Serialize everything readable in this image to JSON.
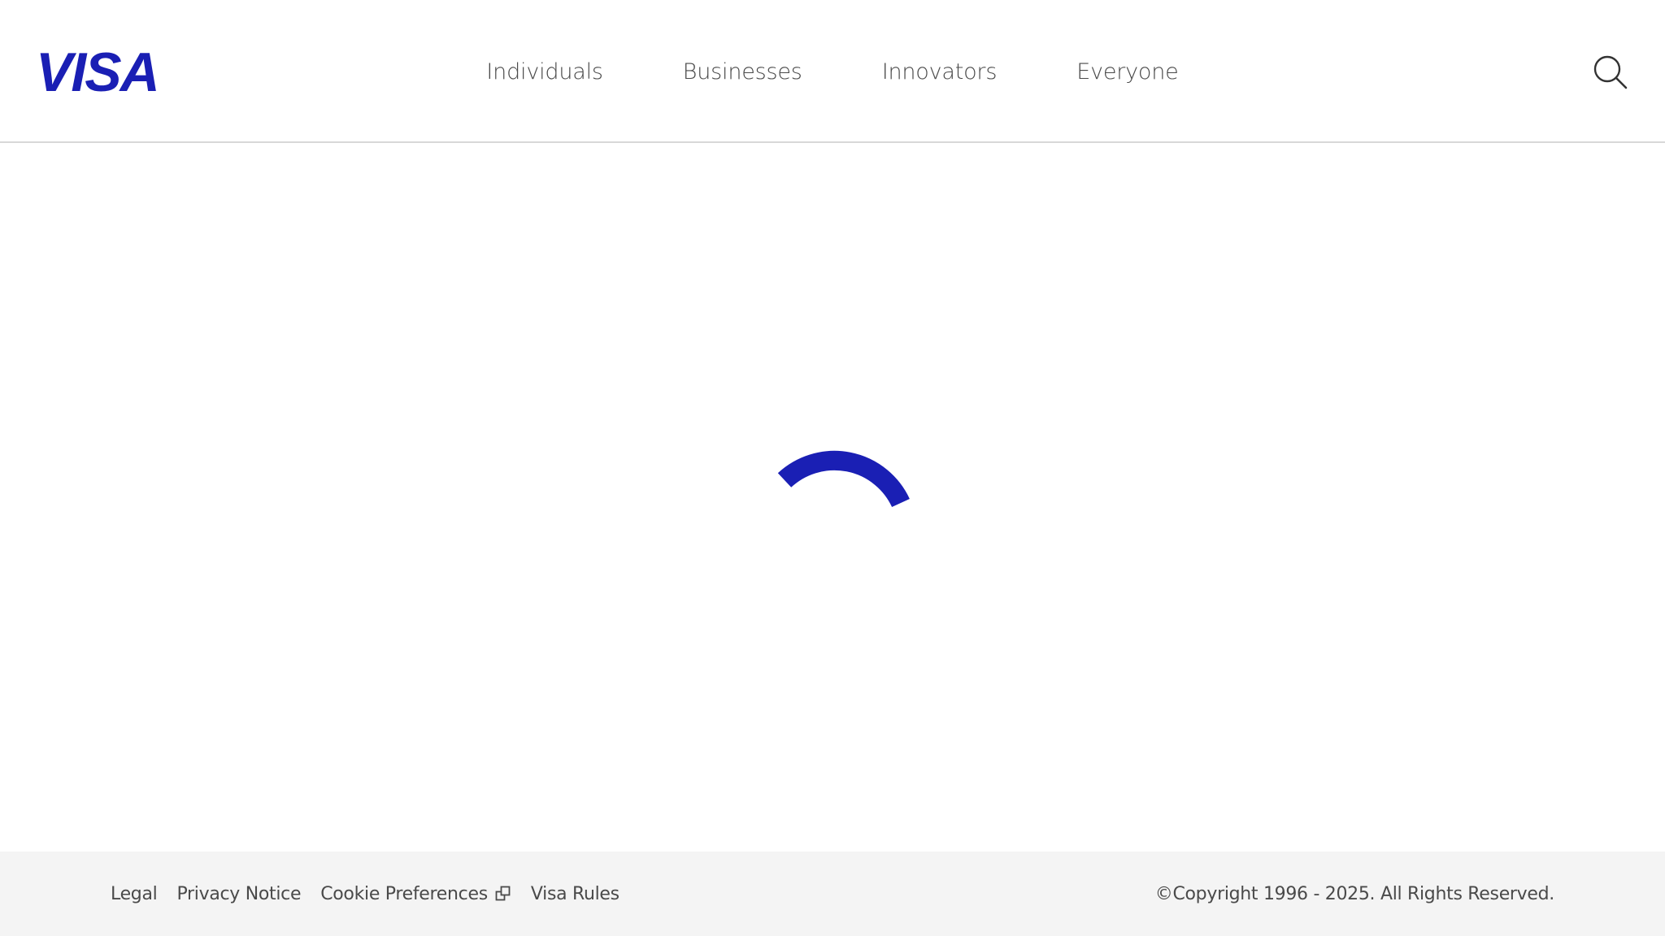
{
  "brand": {
    "name": "VISA",
    "color": "#1a1fb4"
  },
  "nav": {
    "items": [
      {
        "label": "Individuals"
      },
      {
        "label": "Businesses"
      },
      {
        "label": "Innovators"
      },
      {
        "label": "Everyone"
      }
    ]
  },
  "search": {
    "icon": "search-icon"
  },
  "loader": {
    "icon": "loading-spinner-icon",
    "color": "#1a1fb4"
  },
  "footer": {
    "links": [
      {
        "label": "Legal"
      },
      {
        "label": "Privacy Notice"
      },
      {
        "label": "Cookie Preferences",
        "icon": "external-link-icon"
      },
      {
        "label": "Visa Rules"
      }
    ],
    "copyright": "©Copyright 1996 - 2025. All Rights Reserved.",
    "background": "#f4f4f4"
  }
}
